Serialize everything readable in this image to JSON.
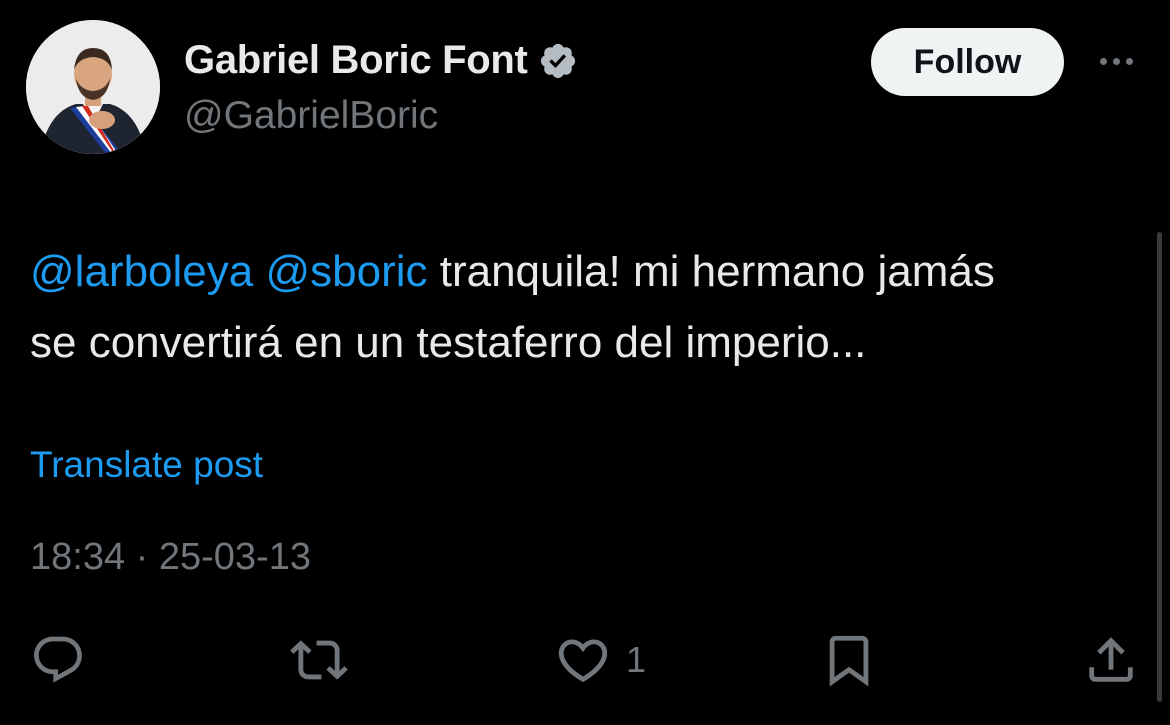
{
  "author": {
    "display_name": "Gabriel Boric Font",
    "handle": "@GabrielBoric",
    "verified_icon": "verified-badge-icon",
    "avatar": "profile-photo-avatar"
  },
  "header": {
    "follow_label": "Follow",
    "more_icon": "more-options-icon"
  },
  "tweet": {
    "mentions": [
      "@larboleya",
      "@sboric"
    ],
    "text_line1": " tranquila! mi hermano jamás",
    "text_line2": "se convertirá en un testaferro del imperio..."
  },
  "translate_label": "Translate post",
  "timestamp": "18:34 · 25-03-13",
  "actions": {
    "reply_icon": "reply-icon",
    "retweet_icon": "retweet-icon",
    "like_icon": "heart-icon",
    "like_count": "1",
    "bookmark_icon": "bookmark-icon",
    "share_icon": "share-icon"
  },
  "colors": {
    "background": "#000000",
    "primary_text": "#e7e9ea",
    "secondary_text": "#71767b",
    "accent": "#1d9bf0",
    "follow_bg": "#eff3f4"
  }
}
